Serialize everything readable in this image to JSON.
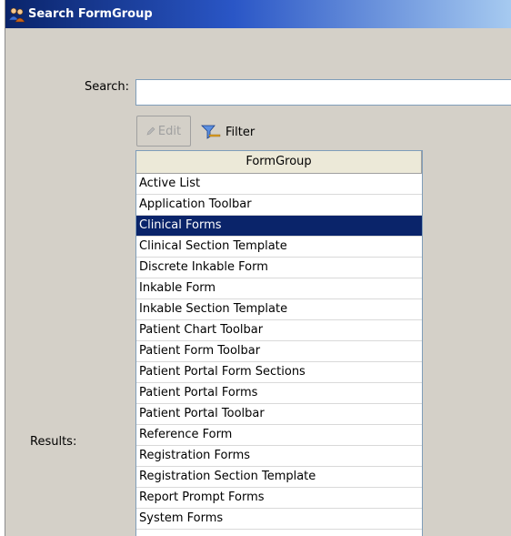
{
  "window": {
    "title": "Search FormGroup",
    "title_icon": "people-icon"
  },
  "search": {
    "label": "Search:",
    "value": "",
    "placeholder": ""
  },
  "toolbar": {
    "edit_label": "Edit",
    "edit_enabled": false,
    "filter_label": "Filter"
  },
  "results": {
    "label": "Results:",
    "column_header": "FormGroup",
    "selected_index": 2,
    "items": [
      "Active List",
      "Application Toolbar",
      "Clinical Forms",
      "Clinical Section Template",
      "Discrete Inkable Form",
      "Inkable Form",
      "Inkable Section Template",
      "Patient Chart Toolbar",
      "Patient Form Toolbar",
      "Patient Portal Form Sections",
      "Patient Portal Forms",
      "Patient Portal Toolbar",
      "Reference Form",
      "Registration Forms",
      "Registration Section Template",
      "Report Prompt Forms",
      "System Forms",
      ""
    ]
  },
  "colors": {
    "title_start": "#0a246a",
    "title_end": "#a6caf0",
    "selection": "#0a246a",
    "panel": "#d4d0c8"
  }
}
